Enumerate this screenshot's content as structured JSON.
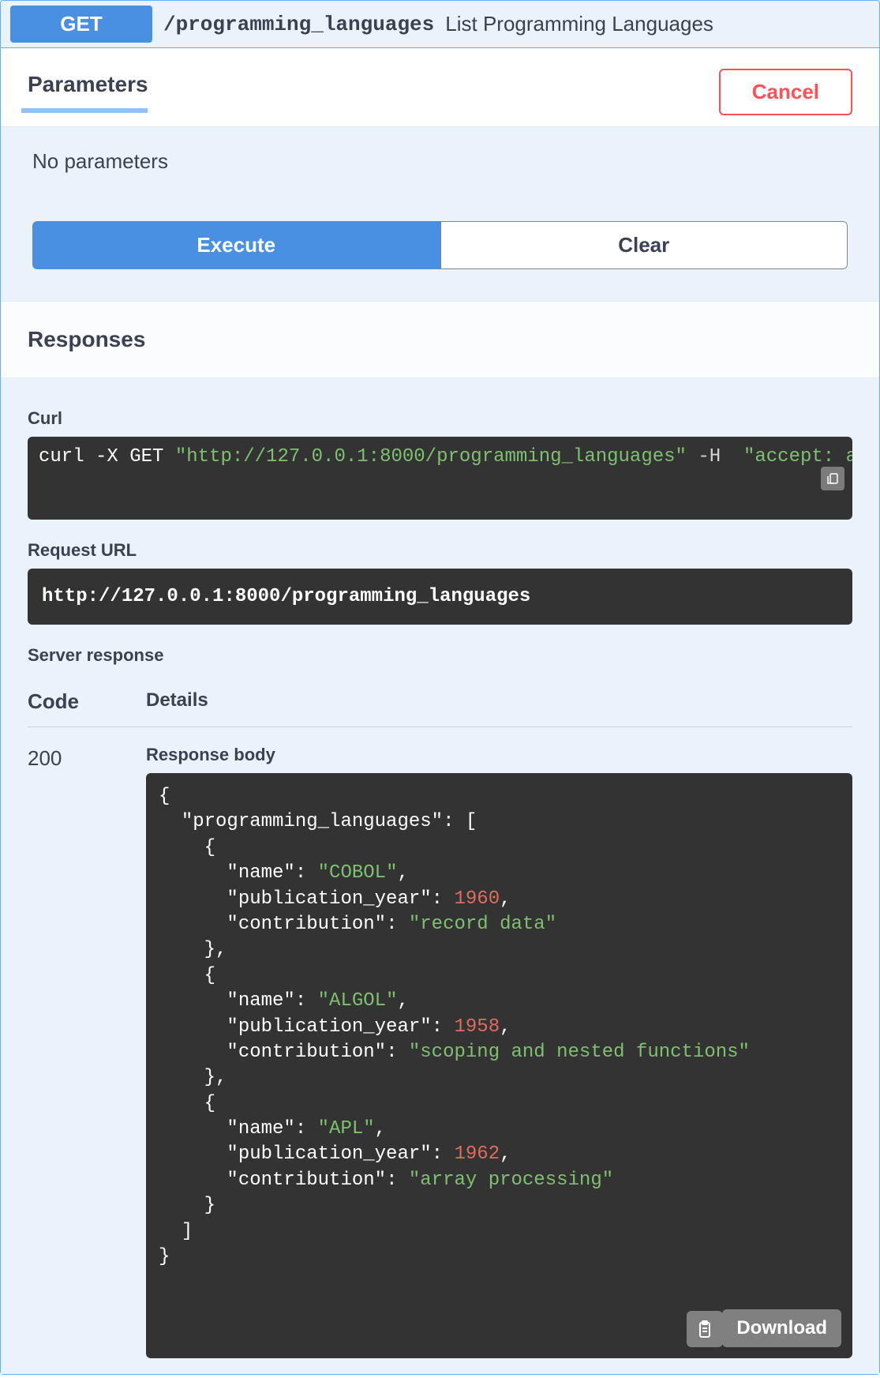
{
  "summary": {
    "method": "GET",
    "path": "/programming_languages",
    "description": "List Programming Languages"
  },
  "parameters": {
    "heading": "Parameters",
    "cancel_label": "Cancel",
    "empty_text": "No parameters",
    "execute_label": "Execute",
    "clear_label": "Clear"
  },
  "responses": {
    "heading": "Responses",
    "curl_heading": "Curl",
    "curl_prefix": "curl -X GET ",
    "curl_url": "\"http://127.0.0.1:8000/programming_languages\"",
    "curl_flag": " -H  ",
    "curl_header": "\"accept: applicat",
    "request_url_heading": "Request URL",
    "request_url": "http://127.0.0.1:8000/programming_languages",
    "server_response_heading": "Server response",
    "code_heading": "Code",
    "details_heading": "Details",
    "status_code": "200",
    "response_body_heading": "Response body",
    "download_label": "Download",
    "response_body": {
      "programming_languages": [
        {
          "name": "COBOL",
          "publication_year": 1960,
          "contribution": "record data"
        },
        {
          "name": "ALGOL",
          "publication_year": 1958,
          "contribution": "scoping and nested functions"
        },
        {
          "name": "APL",
          "publication_year": 1962,
          "contribution": "array processing"
        }
      ]
    }
  }
}
